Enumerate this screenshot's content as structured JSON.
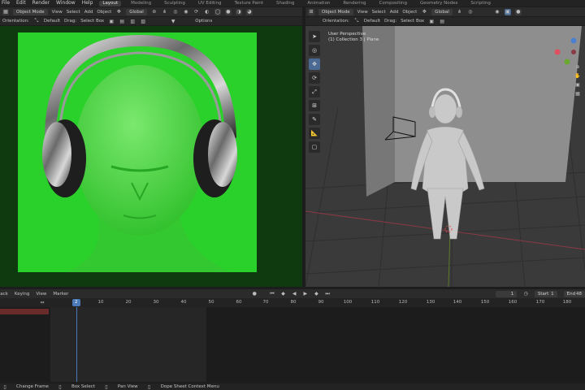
{
  "top_menu": [
    "File",
    "Edit",
    "Render",
    "Window",
    "Help"
  ],
  "workspaces": [
    {
      "label": "Layout",
      "active": true
    },
    {
      "label": "Modeling",
      "active": false
    },
    {
      "label": "Sculpting",
      "active": false
    },
    {
      "label": "UV Editing",
      "active": false
    },
    {
      "label": "Texture Paint",
      "active": false
    },
    {
      "label": "Shading",
      "active": false
    },
    {
      "label": "Animation",
      "active": false
    },
    {
      "label": "Rendering",
      "active": false
    },
    {
      "label": "Compositing",
      "active": false
    },
    {
      "label": "Geometry Nodes",
      "active": false
    },
    {
      "label": "Scripting",
      "active": false
    }
  ],
  "left_header": {
    "mode": "Object Mode",
    "menus": [
      "View",
      "Select",
      "Add",
      "Object"
    ],
    "transform": "Global",
    "orientation_label": "Orientation:",
    "orientation_value": "Default",
    "drag_label": "Drag:",
    "drag_value": "Select Box",
    "options": "Options"
  },
  "right_header": {
    "mode": "Object Mode",
    "menus": [
      "View",
      "Select",
      "Add",
      "Object"
    ],
    "transform": "Global",
    "orientation_label": "Orientation:",
    "orientation_value": "Default",
    "drag_label": "Drag:",
    "drag_value": "Select Box"
  },
  "viewport": {
    "perspective": "User Perspective",
    "collection": "(1) Collection 3 | Plane"
  },
  "timeline": {
    "menus": [
      "Playback",
      "Keying",
      "View",
      "Marker"
    ],
    "current_frame": "1",
    "start_label": "Start",
    "start_value": "1",
    "end_label": "End",
    "end_value": "48",
    "ruler_ticks": [
      "10",
      "20",
      "30",
      "40",
      "50",
      "60",
      "70",
      "80",
      "90",
      "100",
      "110",
      "120",
      "130",
      "140",
      "150",
      "160",
      "170",
      "180"
    ],
    "playhead_frame": "2"
  },
  "status_bar": [
    "Change Frame",
    "Box Select",
    "Pan View",
    "Dope Sheet Context Menu"
  ]
}
